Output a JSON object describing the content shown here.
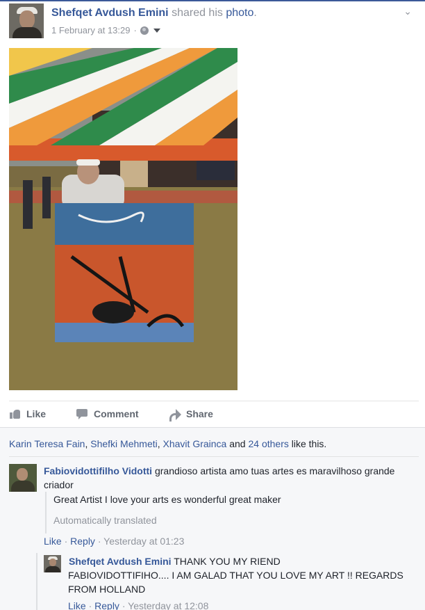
{
  "post": {
    "author": "Shefqet Avdush Emini",
    "verb": "shared his",
    "object": "photo",
    "period": ".",
    "timestamp": "1 February at 13:29",
    "separator": "·",
    "privacy_icon": "globe-icon",
    "menu_icon": "chevron-down-icon"
  },
  "actions": {
    "like": "Like",
    "comment": "Comment",
    "share": "Share"
  },
  "likes": {
    "names": [
      "Karin Teresa Fain",
      "Shefki Mehmeti",
      "Xhavit Grainca"
    ],
    "comma": ",",
    "and": "and",
    "others": "24 others",
    "suffix": "like this."
  },
  "comments": [
    {
      "author": "Fabiovidottifilho Vidotti",
      "text": "grandioso artista amo tuas artes es maravilhoso grande criador",
      "translation": "Great Artist I love your arts es wonderful great maker",
      "translation_note": "Automatically translated",
      "like": "Like",
      "reply": "Reply",
      "time": "Yesterday at 01:23",
      "sep": "·"
    }
  ],
  "reply": {
    "author": "Shefqet Avdush Emini",
    "text_line1": "THANK YOU MY RIEND",
    "text_rest": "FABIOVIDOTTIFIHO.... I AM GALAD THAT YOU LOVE MY ART !! REGARDS FROM HOLLAND",
    "like": "Like",
    "reply": "Reply",
    "time": "Yesterday at 12:08",
    "sep": "·"
  },
  "colors": {
    "link": "#365899",
    "muted": "#90949c",
    "accent_bar": "#3b5998"
  }
}
